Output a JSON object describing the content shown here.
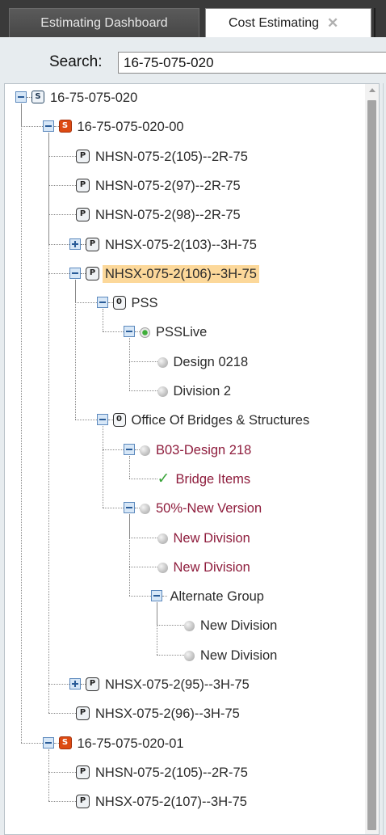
{
  "tabs": [
    {
      "label": "Estimating Dashboard",
      "active": false
    },
    {
      "label": "Cost Estimating",
      "active": true,
      "close_icon": "close-icon"
    }
  ],
  "search": {
    "label": "Search:",
    "value": "16-75-075-020"
  },
  "colors": {
    "selection_highlight": "#fcd89a",
    "secondary_text": "#8e1c3c",
    "estimate_badge": "#dd4a12",
    "expander_fill": "#d7e7f7"
  },
  "tree": [
    {
      "label": "16-75-075-020",
      "icon": "project-s-icon",
      "expander": "expanded",
      "level": 0
    },
    {
      "label": "16-75-075-020-00",
      "icon": "estimate-s-icon",
      "expander": "expanded",
      "level": 1
    },
    {
      "label": "NHSN-075-2(105)--2R-75",
      "icon": "p-icon",
      "expander": "none",
      "level": 2
    },
    {
      "label": "NHSN-075-2(97)--2R-75",
      "icon": "p-icon",
      "expander": "none",
      "level": 2
    },
    {
      "label": "NHSN-075-2(98)--2R-75",
      "icon": "p-icon",
      "expander": "none",
      "level": 2
    },
    {
      "label": "NHSX-075-2(103)--3H-75",
      "icon": "p-icon",
      "expander": "collapsed",
      "level": 2
    },
    {
      "label": "NHSX-075-2(106)--3H-75",
      "icon": "p-icon",
      "expander": "expanded",
      "level": 2,
      "selected": true
    },
    {
      "label": "PSS",
      "icon": "zero-icon",
      "expander": "expanded",
      "level": 3
    },
    {
      "label": "PSSLive",
      "icon": "status-green-icon",
      "expander": "expanded",
      "level": 4
    },
    {
      "label": "Design 0218",
      "icon": "status-gray-icon",
      "expander": "none",
      "level": 5
    },
    {
      "label": "Division 2",
      "icon": "status-gray-icon",
      "expander": "none",
      "level": 5
    },
    {
      "label": "Office Of Bridges & Structures",
      "icon": "zero-icon",
      "expander": "expanded",
      "level": 3
    },
    {
      "label": "B03-Design 218",
      "icon": "status-gray-icon",
      "expander": "expanded",
      "level": 4,
      "red": true
    },
    {
      "label": "Bridge Items",
      "icon": "checkmark-icon",
      "expander": "none",
      "level": 5,
      "red": true
    },
    {
      "label": "50%-New Version",
      "icon": "status-gray-icon",
      "expander": "expanded",
      "level": 4,
      "red": true
    },
    {
      "label": "New Division",
      "icon": "status-gray-icon",
      "expander": "none",
      "level": 5,
      "red": true
    },
    {
      "label": "New Division",
      "icon": "status-gray-icon",
      "expander": "none",
      "level": 5,
      "red": true
    },
    {
      "label": "Alternate Group",
      "icon": "none",
      "expander": "expanded",
      "level": 5
    },
    {
      "label": "New Division",
      "icon": "status-gray-icon",
      "expander": "none",
      "level": 6
    },
    {
      "label": "New Division",
      "icon": "status-gray-icon",
      "expander": "none",
      "level": 6
    },
    {
      "label": "NHSX-075-2(95)--3H-75",
      "icon": "p-icon",
      "expander": "collapsed",
      "level": 2
    },
    {
      "label": "NHSX-075-2(96)--3H-75",
      "icon": "p-icon",
      "expander": "none",
      "level": 2
    },
    {
      "label": "16-75-075-020-01",
      "icon": "estimate-s-icon",
      "expander": "expanded",
      "level": 1
    },
    {
      "label": "NHSN-075-2(105)--2R-75",
      "icon": "p-icon",
      "expander": "none",
      "level": 2
    },
    {
      "label": "NHSX-075-2(107)--3H-75",
      "icon": "p-icon",
      "expander": "none",
      "level": 2
    }
  ]
}
